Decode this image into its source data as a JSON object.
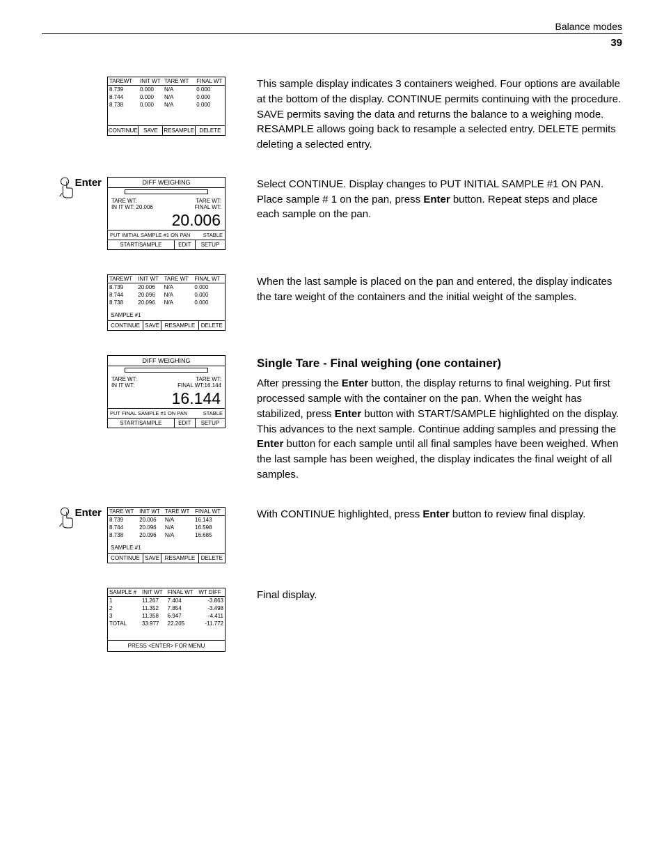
{
  "header": {
    "section": "Balance modes",
    "pagenum": "39"
  },
  "labels": {
    "enter": "Enter"
  },
  "lcd_common": {
    "headers4": [
      "TAREWT",
      "INIT WT",
      "TARE WT",
      "FINAL WT"
    ],
    "headers4b": [
      "TARE WT",
      "INIT WT",
      "TARE WT",
      "FINAL WT"
    ],
    "btns": [
      "CONTINUE",
      "SAVE",
      "RESAMPLE",
      "DELETE"
    ],
    "btns3": [
      "START/SAMPLE",
      "EDIT",
      "SETUP"
    ],
    "diff_title": "DIFF WEIGHING",
    "sample1": "SAMPLE #1"
  },
  "b1": {
    "rows": [
      [
        "8.739",
        "0.000",
        "N/A",
        "0.000"
      ],
      [
        "8.744",
        "0.000",
        "N/A",
        "0.000"
      ],
      [
        "8.738",
        "0.000",
        "N/A",
        "0.000"
      ]
    ],
    "text": "This sample display indicates 3 containers weighed. Four options are available at the bottom of the display. CONTINUE permits continuing with the procedure. SAVE permits saving the data and returns the balance to a weighing mode. RESAMPLE allows going back to resample a selected entry. DELETE permits deleting a selected entry."
  },
  "b2": {
    "l1": "TARE WT:",
    "l2": "TARE WT:",
    "l3": "IN IT WT: 20.006",
    "l4": "FINAL WT:",
    "big": "20.006",
    "msg_l": "PUT INITIAL SAMPLE #1 ON PAN",
    "msg_r": "STABLE",
    "text_pre": "Select CONTINUE. Display changes to PUT INITIAL SAMPLE #1 ON PAN. Place sample # 1 on the pan, press ",
    "text_bold": "Enter",
    "text_post": " button. Repeat steps and place each sample on the pan."
  },
  "b3": {
    "rows": [
      [
        "8.739",
        "20.006",
        "N/A",
        "0.000"
      ],
      [
        "8.744",
        "20.096",
        "N/A",
        "0.000"
      ],
      [
        "8.738",
        "20.096",
        "N/A",
        "0.000"
      ]
    ],
    "text": "When the last sample is placed on the pan and entered, the display indicates the tare weight of the containers and the initial weight of the samples."
  },
  "b4": {
    "l1": "TARE WT:",
    "l2": "TARE WT:",
    "l3": "IN IT WT:",
    "l4": "FINAL WT:16.144",
    "big": "16.144",
    "msg_l": "PUT FINAL SAMPLE #1 ON PAN",
    "msg_r": "STABLE",
    "heading": "Single Tare - Final weighing (one container)",
    "t1": "After pressing the ",
    "tb1": "Enter",
    "t2": " button, the display returns to final weighing. Put first processed sample with the container on the pan. When the weight has stabilized, press ",
    "tb2": "Enter",
    "t3": " button with START/SAMPLE highlighted on the display. This advances to the next sample. Continue adding samples and pressing the ",
    "tb3": "Enter",
    "t4": " button for each sample until all final samples have been weighed. When the last sample has been weighed, the display indicates the final weight of all samples."
  },
  "b5": {
    "rows": [
      [
        "8.739",
        "20.006",
        "N/A",
        "16.143"
      ],
      [
        "8.744",
        "20.096",
        "N/A",
        "16.598"
      ],
      [
        "8.738",
        "20.096",
        "N/A",
        "16.685"
      ]
    ],
    "t1": "With CONTINUE highlighted, press ",
    "tb": "Enter",
    "t2": " button to review final display."
  },
  "b6": {
    "headers": [
      "SAMPLE #",
      "INIT WT",
      "FINAL WT",
      "WT DIFF"
    ],
    "rows": [
      [
        "1",
        "11.267",
        "7.404",
        "-3.863"
      ],
      [
        "2",
        "11.352",
        "7.854",
        "-3.498"
      ],
      [
        "3",
        "11.358",
        "6.947",
        "-4.411"
      ],
      [
        "TOTAL",
        "33.977",
        "22.205",
        "-11.772"
      ]
    ],
    "footer": "PRESS <ENTER> FOR MENU",
    "text": "Final display."
  }
}
